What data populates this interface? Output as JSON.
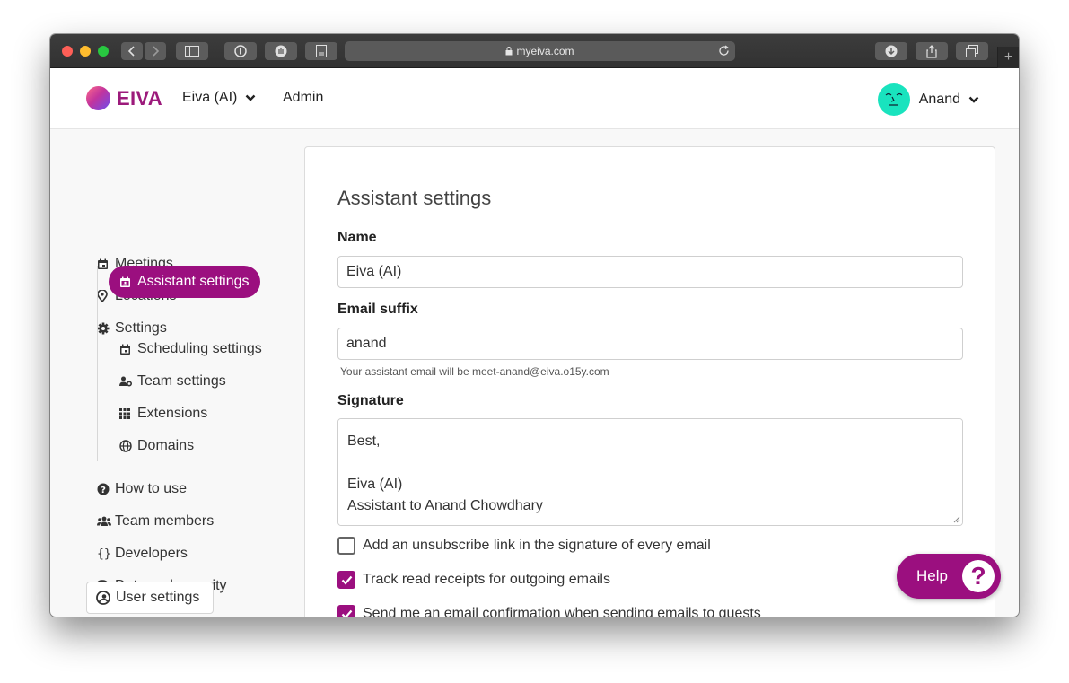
{
  "browser": {
    "url": "myeiva.com"
  },
  "header": {
    "brand": "EIVA",
    "team_switcher": "Eiva (AI)",
    "admin_link": "Admin",
    "user_name": "Anand"
  },
  "sidebar": {
    "items": [
      {
        "label": "Meetings",
        "icon": "calendar-icon"
      },
      {
        "label": "Locations",
        "icon": "map-pin-icon"
      },
      {
        "label": "Settings",
        "icon": "gear-icon"
      }
    ],
    "settings_subitems": [
      {
        "label": "Assistant settings",
        "icon": "calendar-user-icon",
        "active": true
      },
      {
        "label": "Scheduling settings",
        "icon": "calendar-icon"
      },
      {
        "label": "Team settings",
        "icon": "user-gear-icon"
      },
      {
        "label": "Extensions",
        "icon": "grid-icon"
      },
      {
        "label": "Domains",
        "icon": "globe-icon"
      }
    ],
    "bottom_items": [
      {
        "label": "How to use",
        "icon": "question-circle-icon"
      },
      {
        "label": "Team members",
        "icon": "users-icon"
      },
      {
        "label": "Developers",
        "icon": "braces-icon"
      },
      {
        "label": "Data and security",
        "icon": "database-icon"
      }
    ],
    "user_settings": "User settings"
  },
  "main": {
    "title": "Assistant settings",
    "name_label": "Name",
    "name_value": "Eiva (AI)",
    "email_suffix_label": "Email suffix",
    "email_suffix_value": "anand",
    "email_help": "Your assistant email will be meet-anand@eiva.o15y.com",
    "signature_label": "Signature",
    "signature_value": "Best,\n\nEiva (AI)\nAssistant to Anand Chowdhary",
    "checkboxes": [
      {
        "label": "Add an unsubscribe link in the signature of every email",
        "checked": false
      },
      {
        "label": "Track read receipts for outgoing emails",
        "checked": true
      },
      {
        "label": "Send me an email confirmation when sending emails to guests",
        "checked": true
      }
    ]
  },
  "help": {
    "label": "Help",
    "icon_glyph": "?"
  },
  "colors": {
    "brand": "#9b0f7f",
    "avatar": "#19e3be"
  }
}
